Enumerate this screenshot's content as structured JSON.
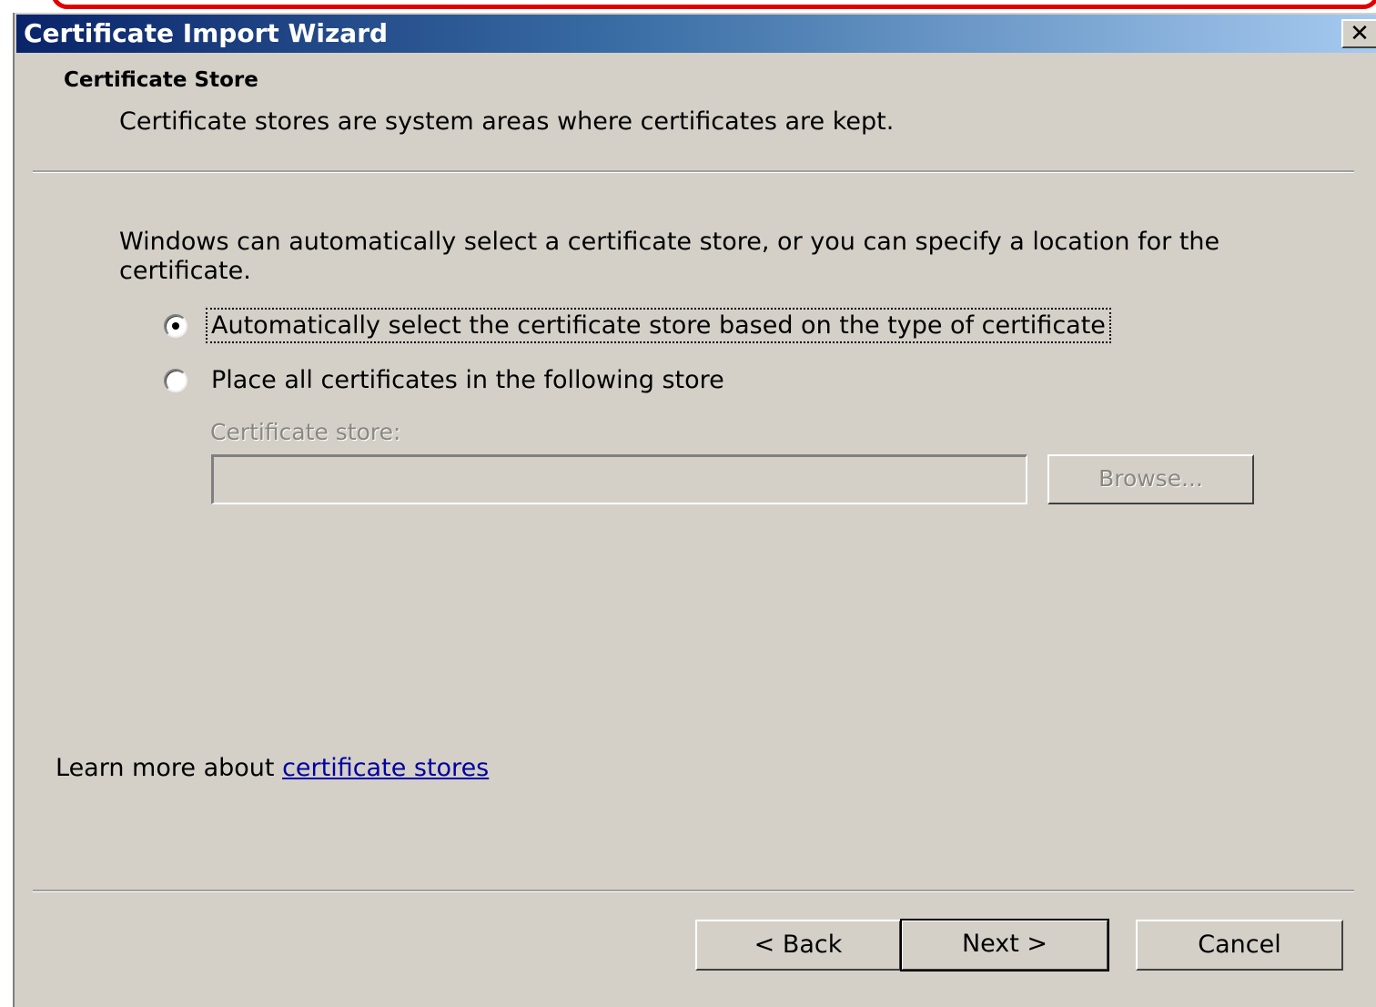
{
  "window": {
    "title": "Certificate Import Wizard",
    "close_label": "✕"
  },
  "header": {
    "title": "Certificate Store",
    "subtitle": "Certificate stores are system areas where certificates are kept."
  },
  "body": {
    "intro": "Windows can automatically select a certificate store, or you can specify a location for the certificate.",
    "options": [
      {
        "label": "Automatically select the certificate store based on the type of certificate",
        "selected": true
      },
      {
        "label": "Place all certificates in the following store",
        "selected": false
      }
    ],
    "store_label": "Certificate store:",
    "store_value": "",
    "browse_label": "Browse..."
  },
  "learn_more": {
    "prefix": "Learn more about ",
    "link_text": "certificate stores"
  },
  "footer": {
    "back_label": "< Back",
    "next_label": "Next >",
    "cancel_label": "Cancel"
  },
  "colors": {
    "dialog_face": "#d4d0c8",
    "title_gradient_start": "#0a246a",
    "title_gradient_end": "#a6caf0",
    "highlight": "#e00000",
    "link": "#0000a0"
  }
}
